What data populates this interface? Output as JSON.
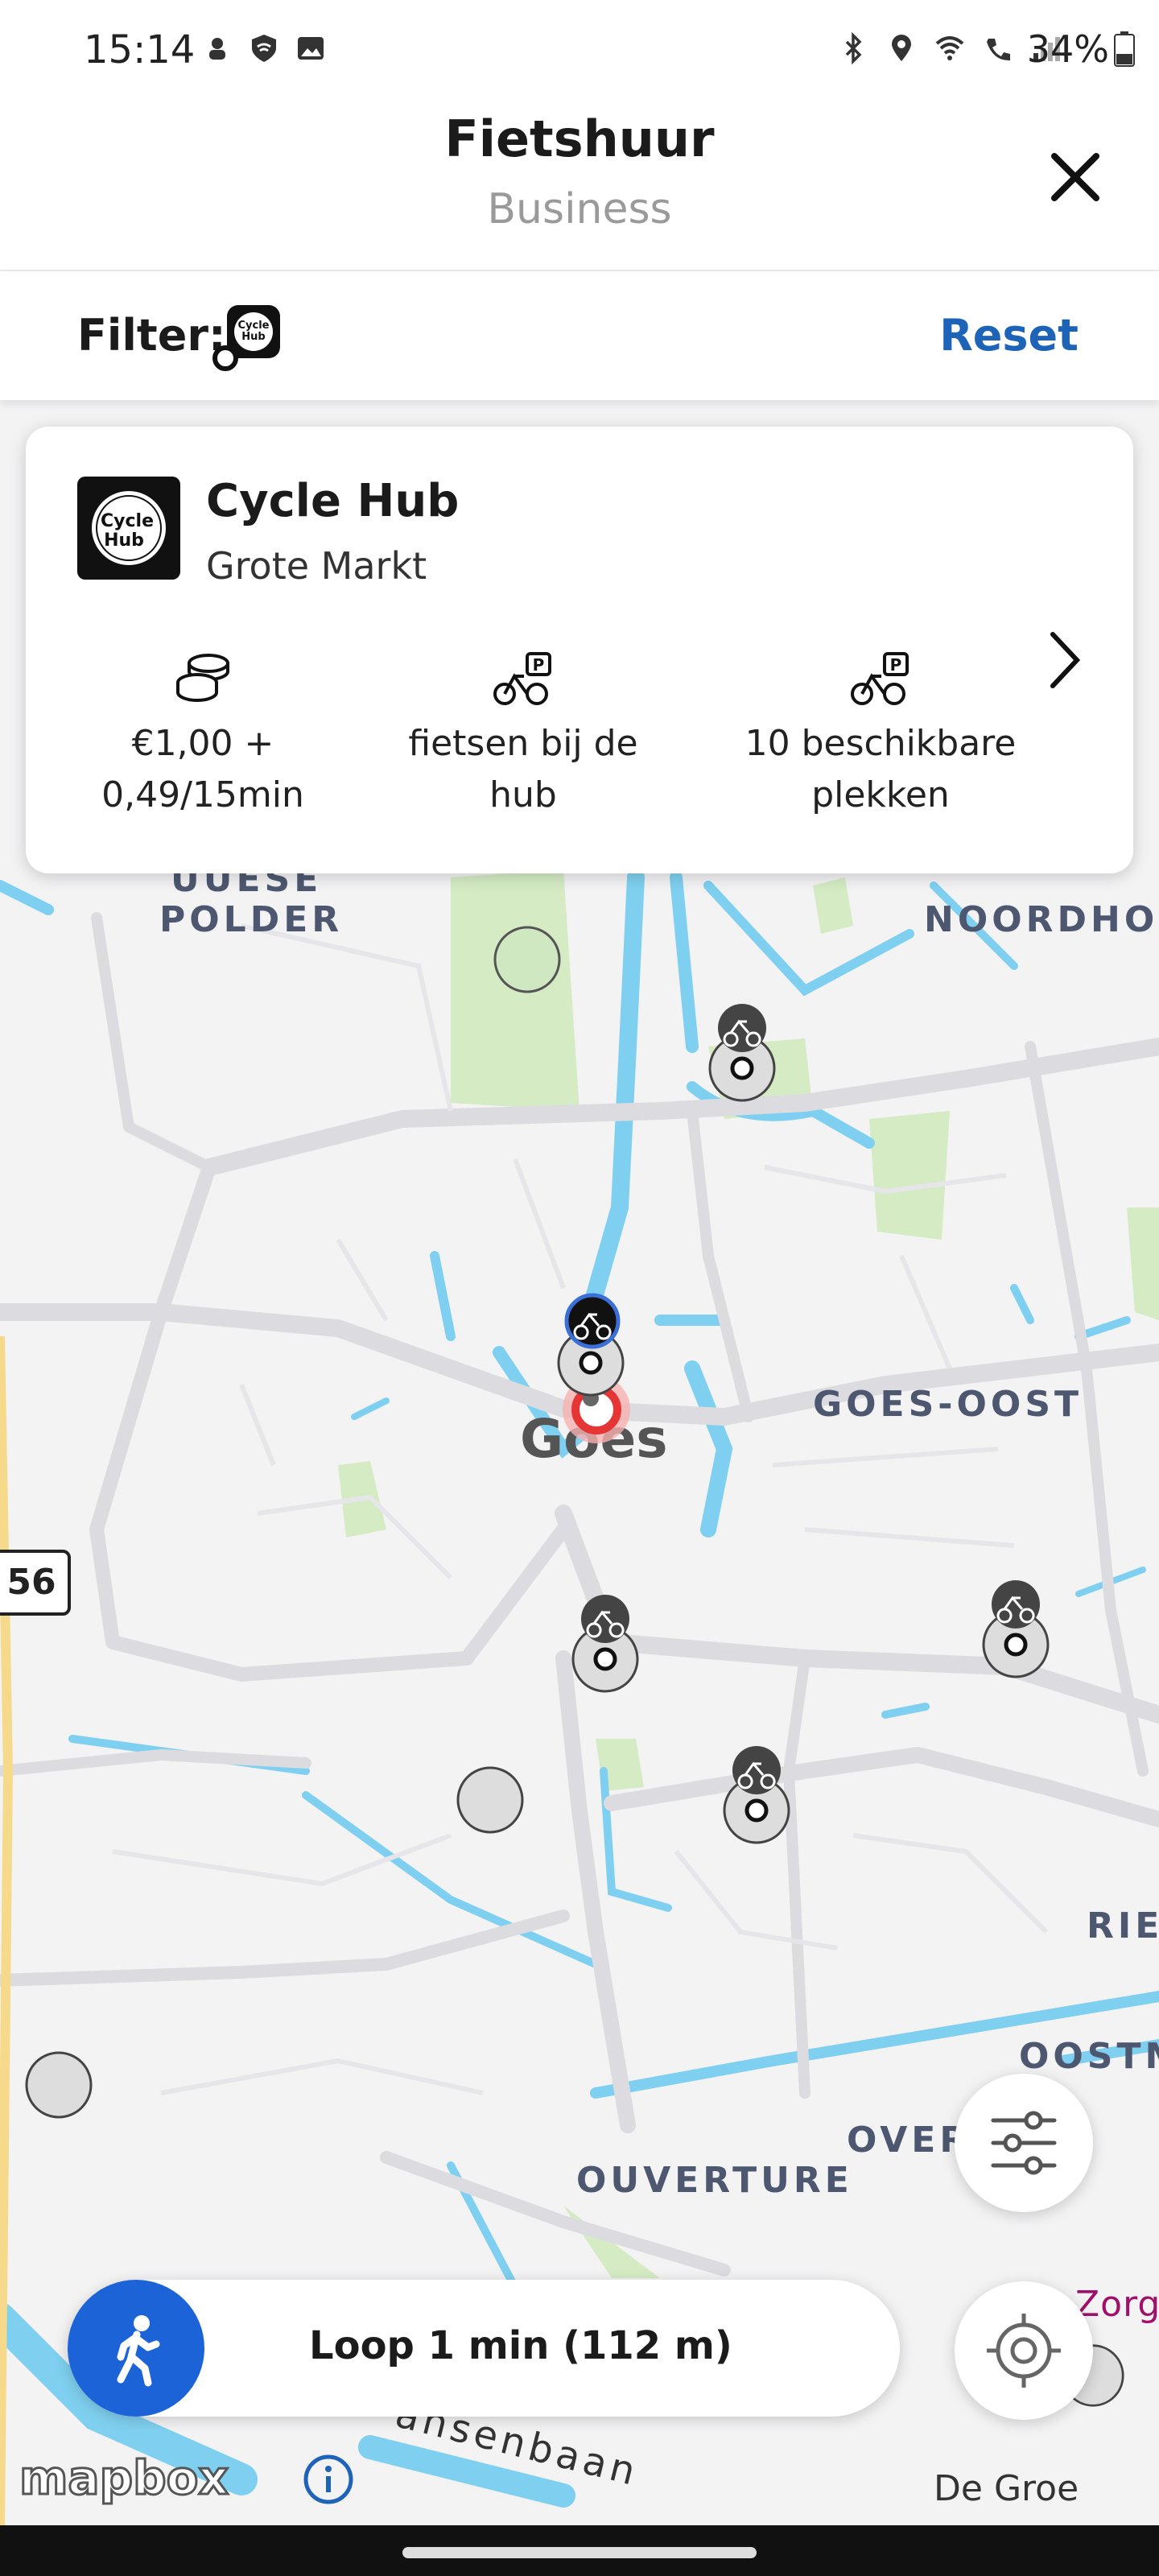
{
  "status_bar": {
    "time": "15:14",
    "battery": "34%"
  },
  "header": {
    "title": "Fietshuur",
    "subtitle": "Business"
  },
  "filter": {
    "label": "Filter:",
    "reset_label": "Reset",
    "active_filter_icon": "cycle-hub-logo-icon"
  },
  "card": {
    "name": "Cycle Hub",
    "location": "Grote Markt",
    "logo_text": "Cycle Hub",
    "stats": [
      {
        "icon": "coins-icon",
        "line1": "€1,00 +",
        "line2": "0,49/15min"
      },
      {
        "icon": "bike-parking-icon",
        "line1": "fietsen bij de",
        "line2": "hub"
      },
      {
        "icon": "bike-parking-icon",
        "line1": "10 beschikbare",
        "line2": "plekken"
      }
    ]
  },
  "map": {
    "labels": {
      "polder1": "UUESE",
      "polder2": "POLDER",
      "noordhoek": "NOORDHOEK",
      "goes_oost": "GOES-OOST",
      "goes": "Goes",
      "road": "56",
      "rie": "RIET",
      "oostm": "OOSTM",
      "over": "OVER",
      "ouverture": "OUVERTURE",
      "street": "ansenbaan",
      "zorg": "Zorgp"
    },
    "attribution": "mapbox",
    "corner_label": "De Groe"
  },
  "walk": {
    "label": "Loop 1 min (112 m)"
  },
  "colors": {
    "accent": "#1d63b8",
    "walk_button": "#1d63d8",
    "water": "#7fd0f0",
    "park": "#c8e6b0"
  }
}
